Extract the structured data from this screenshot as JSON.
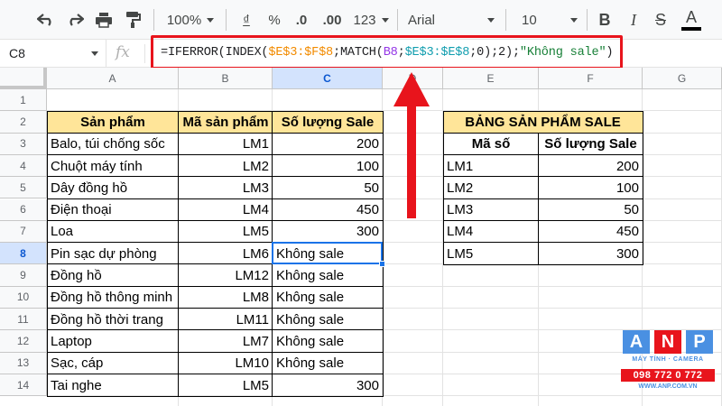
{
  "toolbar": {
    "zoom": "100%",
    "currency": "₫",
    "percent": "%",
    "dec_decrease": ".0",
    "dec_increase": ".00",
    "more_formats": "123",
    "font": "Arial",
    "font_size": "10",
    "bold": "B",
    "italic": "I",
    "strike": "S",
    "text_color": "A"
  },
  "formula_bar": {
    "cell_ref": "C8",
    "fx": "fx",
    "formula_parts": [
      {
        "text": "=IFERROR(INDEX(",
        "color": "default"
      },
      {
        "text": "$E$3:$F$8",
        "color": "orange"
      },
      {
        "text": ";MATCH(",
        "color": "default"
      },
      {
        "text": "B8",
        "color": "purple"
      },
      {
        "text": ";",
        "color": "default"
      },
      {
        "text": "$E$3:$E$8",
        "color": "teal"
      },
      {
        "text": ";0);2);",
        "color": "default"
      },
      {
        "text": "\"Không sale\"",
        "color": "green"
      },
      {
        "text": ")",
        "color": "default"
      }
    ]
  },
  "columns": [
    "A",
    "B",
    "C",
    "D",
    "E",
    "F",
    "G"
  ],
  "rows": [
    "1",
    "2",
    "3",
    "4",
    "5",
    "6",
    "7",
    "8",
    "9",
    "10",
    "11",
    "12",
    "13",
    "14"
  ],
  "selected_cell": {
    "col": "C",
    "row": "8"
  },
  "table1": {
    "headers": [
      "Sản phẩm",
      "Mã sản phẩm",
      "Số lượng Sale"
    ],
    "rows": [
      [
        "Balo, túi chống sốc",
        "LM1",
        "200"
      ],
      [
        "Chuột máy tính",
        "LM2",
        "100"
      ],
      [
        "Dây đồng hồ",
        "LM3",
        "50"
      ],
      [
        "Điện thoại",
        "LM4",
        "450"
      ],
      [
        "Loa",
        "LM5",
        "300"
      ],
      [
        "Pin sạc dự phòng",
        "LM6",
        "Không sale"
      ],
      [
        "Đồng hồ",
        "LM12",
        "Không sale"
      ],
      [
        "Đồng hồ thông minh",
        "LM8",
        "Không sale"
      ],
      [
        "Đồng hồ thời trang",
        "LM11",
        "Không sale"
      ],
      [
        "Laptop",
        "LM7",
        "Không sale"
      ],
      [
        "Sạc, cáp",
        "LM10",
        "Không sale"
      ],
      [
        "Tai nghe",
        "LM5",
        "300"
      ]
    ]
  },
  "table2": {
    "title": "BẢNG SẢN PHẨM SALE",
    "headers": [
      "Mã số",
      "Số lượng Sale"
    ],
    "rows": [
      [
        "LM1",
        "200"
      ],
      [
        "LM2",
        "100"
      ],
      [
        "LM3",
        "50"
      ],
      [
        "LM4",
        "450"
      ],
      [
        "LM5",
        "300"
      ]
    ]
  },
  "logo": {
    "letters": [
      "A",
      "N",
      "P"
    ],
    "letter_colors": [
      "#4a90e2",
      "#e8141c",
      "#4a90e2"
    ],
    "tagline": "MÁY TÍNH · CAMERA",
    "phone": "098 772 0 772",
    "website": "WWW.ANP.COM.VN"
  },
  "colors": {
    "header_fill": "#ffe599",
    "highlight_red": "#e8141c",
    "selection_blue": "#1a73e8"
  }
}
